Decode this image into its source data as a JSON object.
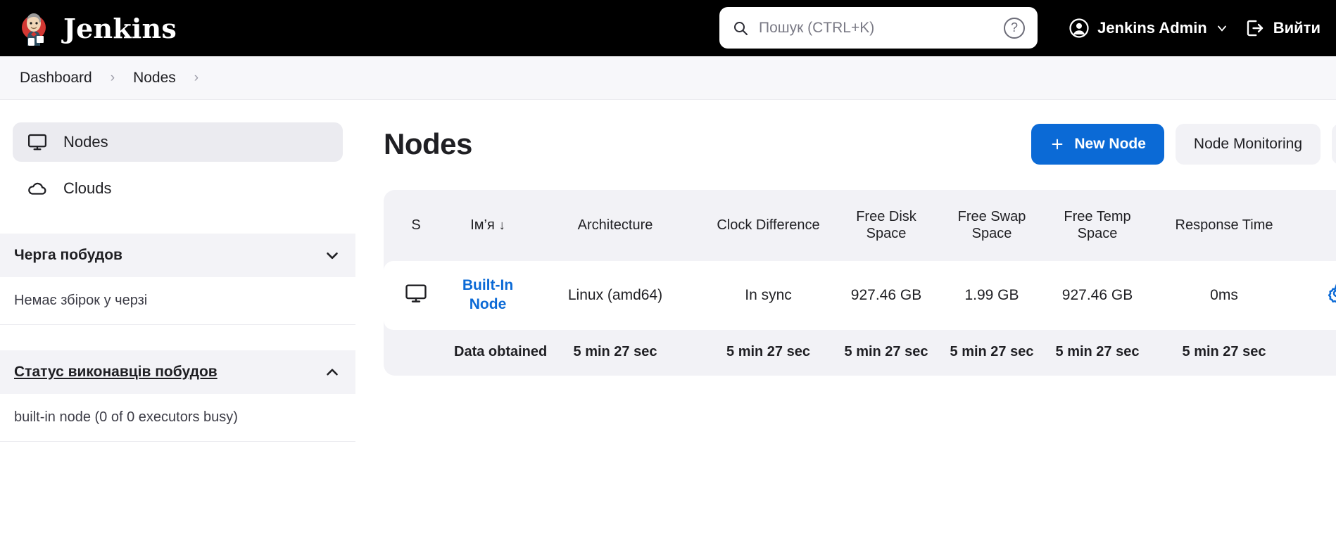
{
  "header": {
    "brand": "Jenkins",
    "search": {
      "placeholder": "Пошук (CTRL+K)",
      "value": "",
      "icon": "search-icon",
      "help_icon": "help-circle-icon"
    },
    "user": {
      "name": "Jenkins Admin",
      "avatar_icon": "user-circle-icon",
      "chevron_icon": "chevron-down-icon"
    },
    "logout": {
      "label": "Вийти",
      "icon": "logout-icon"
    }
  },
  "breadcrumb": {
    "items": [
      {
        "label": "Dashboard"
      },
      {
        "label": "Nodes"
      }
    ],
    "separator": "›"
  },
  "sidebar": {
    "nav": [
      {
        "label": "Nodes",
        "icon": "monitor-icon",
        "active": true
      },
      {
        "label": "Clouds",
        "icon": "cloud-icon",
        "active": false
      }
    ],
    "panels": [
      {
        "title": "Черга побудов",
        "collapse_icon": "chevron-down-icon",
        "body": "Немає збірок у черзі"
      },
      {
        "title": "Статус виконавців побудов",
        "collapse_icon": "chevron-up-icon",
        "body": "built-in node (0 of 0 executors busy)"
      }
    ]
  },
  "main": {
    "title": "Nodes",
    "actions": {
      "new_node": {
        "label": "New Node",
        "icon": "plus-icon"
      },
      "node_monitoring": {
        "label": "Node Monitoring"
      },
      "refresh": {
        "icon": "refresh-icon"
      }
    },
    "table": {
      "columns": [
        {
          "key": "status",
          "label": "S"
        },
        {
          "key": "name",
          "label": "Ім’я",
          "sort": "↓"
        },
        {
          "key": "architecture",
          "label": "Architecture"
        },
        {
          "key": "clock_difference",
          "label": "Clock Difference"
        },
        {
          "key": "free_disk_space",
          "label": "Free Disk Space"
        },
        {
          "key": "free_swap_space",
          "label": "Free Swap Space"
        },
        {
          "key": "free_temp_space",
          "label": "Free Temp Space"
        },
        {
          "key": "response_time",
          "label": "Response Time"
        },
        {
          "key": "configure",
          "label": ""
        }
      ],
      "rows": [
        {
          "status_icon": "monitor-icon",
          "name": "Built-In Node",
          "architecture": "Linux (amd64)",
          "clock_difference": "In sync",
          "free_disk_space": "927.46 GB",
          "free_swap_space": "1.99 GB",
          "free_temp_space": "927.46 GB",
          "response_time": "0ms",
          "configure_icon": "gear-icon"
        }
      ],
      "footer": {
        "label": "Data obtained",
        "architecture": "5 min 27 sec",
        "clock_difference": "5 min 27 sec",
        "free_disk_space": "5 min 27 sec",
        "free_swap_space": "5 min 27 sec",
        "free_temp_space": "5 min 27 sec",
        "response_time": "5 min 27 sec"
      }
    }
  },
  "colors": {
    "accent": "#0b6ad6",
    "header_bg": "#000000",
    "panel_bg": "#f2f2f6",
    "link": "#0b6ad6"
  }
}
